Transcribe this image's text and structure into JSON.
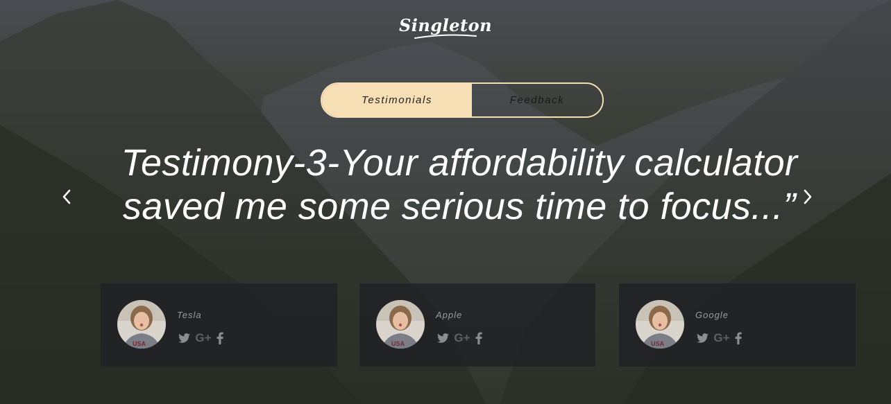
{
  "brand": {
    "logo": "Singleton"
  },
  "tabs": [
    {
      "label": "Testimonials",
      "active": true
    },
    {
      "label": "Feedback",
      "active": false
    }
  ],
  "testimonial": {
    "quote": "Testimony-3-Your affordability calculator saved me some serious time to focus...”"
  },
  "nav": {
    "prev_icon": "chevron-left-icon",
    "next_icon": "chevron-right-icon"
  },
  "clients": [
    {
      "name": "Tesla",
      "socials": [
        "twitter-icon",
        "google-plus-icon",
        "facebook-icon"
      ]
    },
    {
      "name": "Apple",
      "socials": [
        "twitter-icon",
        "google-plus-icon",
        "facebook-icon"
      ]
    },
    {
      "name": "Google",
      "socials": [
        "twitter-icon",
        "google-plus-icon",
        "facebook-icon"
      ]
    }
  ],
  "colors": {
    "tab_accent": "#f6dfb5",
    "card_bg": "#202124",
    "text_white": "#ffffff",
    "muted": "#9a9a9a"
  }
}
